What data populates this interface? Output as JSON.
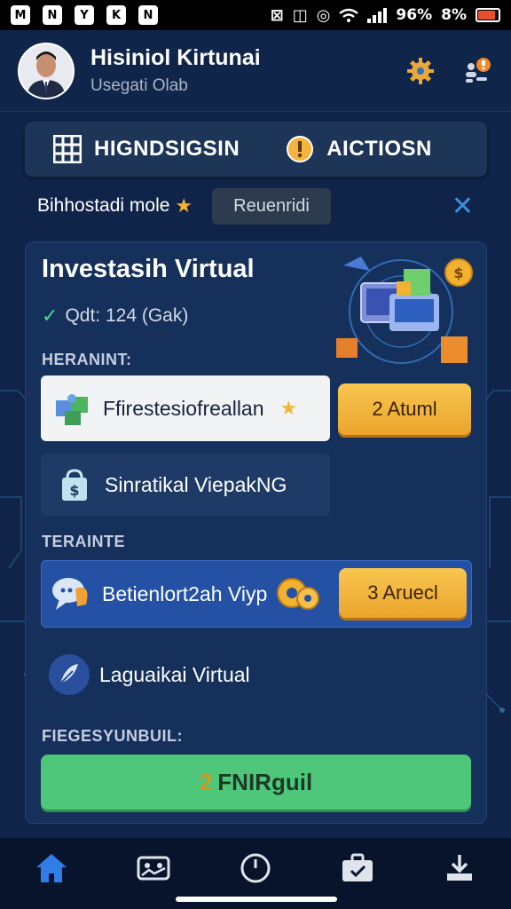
{
  "status_bar": {
    "apps": [
      "M",
      "N",
      "Y",
      "K",
      "N"
    ],
    "battery_percent": "96%",
    "battery_second": "8%",
    "battery_level": 0.85
  },
  "header": {
    "user_name": "Hisiniol Kirtunai",
    "user_subtitle": "Usegati Olab"
  },
  "tabs": [
    {
      "label": "HIGNDSIGSIN",
      "icon": "grid-icon"
    },
    {
      "label": "AICTIOSN",
      "icon": "alert-icon"
    }
  ],
  "filter": {
    "label": "Bihhostadi mole",
    "chip": "Reuenridi"
  },
  "card": {
    "title": "Investasih Virtual",
    "subtitle": "Qdt: 124 (Gak)",
    "section1": "HERANINT:",
    "section2": "TERAINTE",
    "section3": "FIEGESYUNBUIL:",
    "items": [
      {
        "label": "Ffirestesiofreallan",
        "icon": "puzzle-icon"
      },
      {
        "label": "Sinratikal ViepakNG",
        "icon": "lock-bag-icon"
      },
      {
        "label": "Betienlort2ah Viyp",
        "icon": "chat-icon"
      },
      {
        "label": "Laguaikai Virtual",
        "icon": "feather-icon"
      }
    ],
    "btn1": "2 Atuml",
    "btn2": "3 Aruecl",
    "cta_num": "2",
    "cta_text": "FNIRguil"
  },
  "nav": [
    "home-icon",
    "gallery-icon",
    "clock-icon",
    "briefcase-icon",
    "download-icon"
  ],
  "colors": {
    "background": "#0f2448",
    "accent": "#eba42c",
    "cta": "#4fc77a",
    "highlight": "#2451a3"
  }
}
